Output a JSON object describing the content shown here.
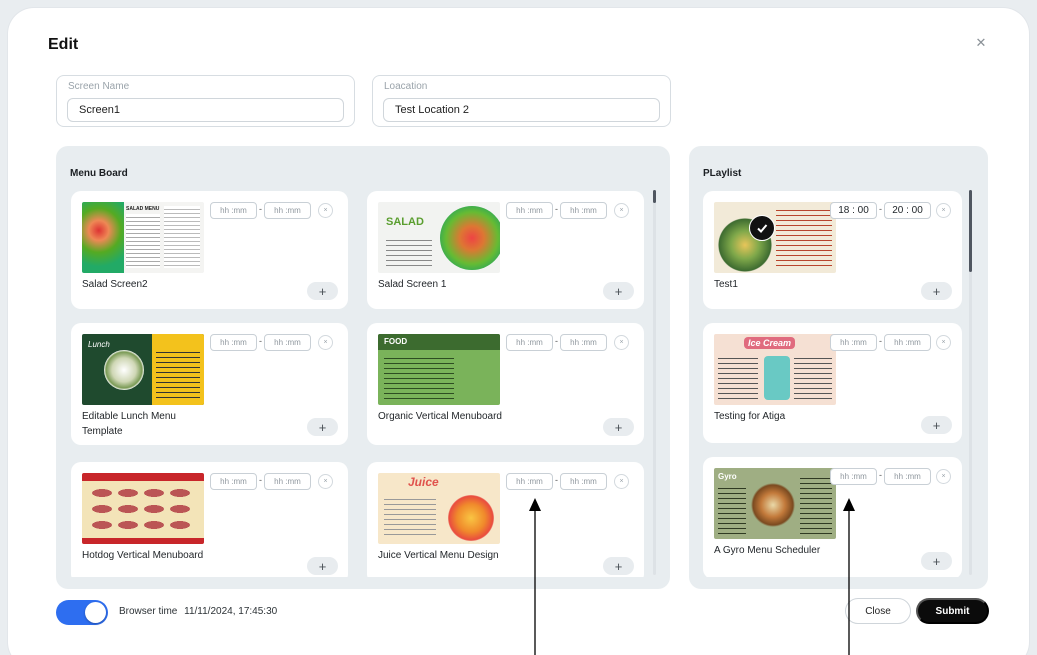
{
  "modal": {
    "title": "Edit",
    "close_icon": "close-icon"
  },
  "form": {
    "screen_name_label": "Screen Name",
    "screen_name_value": "Screen1",
    "location_label": "Loacation",
    "location_value": "Test Location 2"
  },
  "menu_board": {
    "title": "Menu Board",
    "items": [
      {
        "name": "Salad Screen2",
        "start": "hh :mm",
        "end": "hh :mm"
      },
      {
        "name": "Salad Screen 1",
        "start": "hh :mm",
        "end": "hh :mm"
      },
      {
        "name": "Editable Lunch Menu Template",
        "start": "hh :mm",
        "end": "hh :mm"
      },
      {
        "name": "Organic Vertical Menuboard",
        "start": "hh :mm",
        "end": "hh :mm"
      },
      {
        "name": "Hotdog Vertical Menuboard",
        "start": "hh :mm",
        "end": "hh :mm"
      },
      {
        "name": "Juice Vertical Menu Design",
        "start": "hh :mm",
        "end": "hh :mm"
      }
    ],
    "dash": "-",
    "remove_symbol": "×",
    "add_symbol": "+",
    "thumb_labels": [
      "SALAD MENU",
      "SALAD",
      "Lunch",
      "FOOD",
      "",
      "Juice"
    ]
  },
  "playlist": {
    "title": "PLaylist",
    "items": [
      {
        "name": "Test1",
        "start": "18 : 00",
        "end": "20 : 00",
        "selected": true
      },
      {
        "name": "Testing for Atiga",
        "start": "hh :mm",
        "end": "hh :mm",
        "selected": false
      },
      {
        "name": "A Gyro Menu Scheduler",
        "start": "hh :mm",
        "end": "hh :mm",
        "selected": false
      }
    ],
    "thumb_labels": [
      "",
      "Ice Cream",
      "Gyro"
    ]
  },
  "footer": {
    "browser_time_label": "Browser time",
    "browser_time_value": "11/11/2024, 17:45:30",
    "toggle_on": true,
    "close_label": "Close",
    "submit_label": "Submit"
  },
  "colors": {
    "accent": "#2e6ef0",
    "submit_bg": "#0b0b0b",
    "panel_bg": "#e8edf0"
  }
}
